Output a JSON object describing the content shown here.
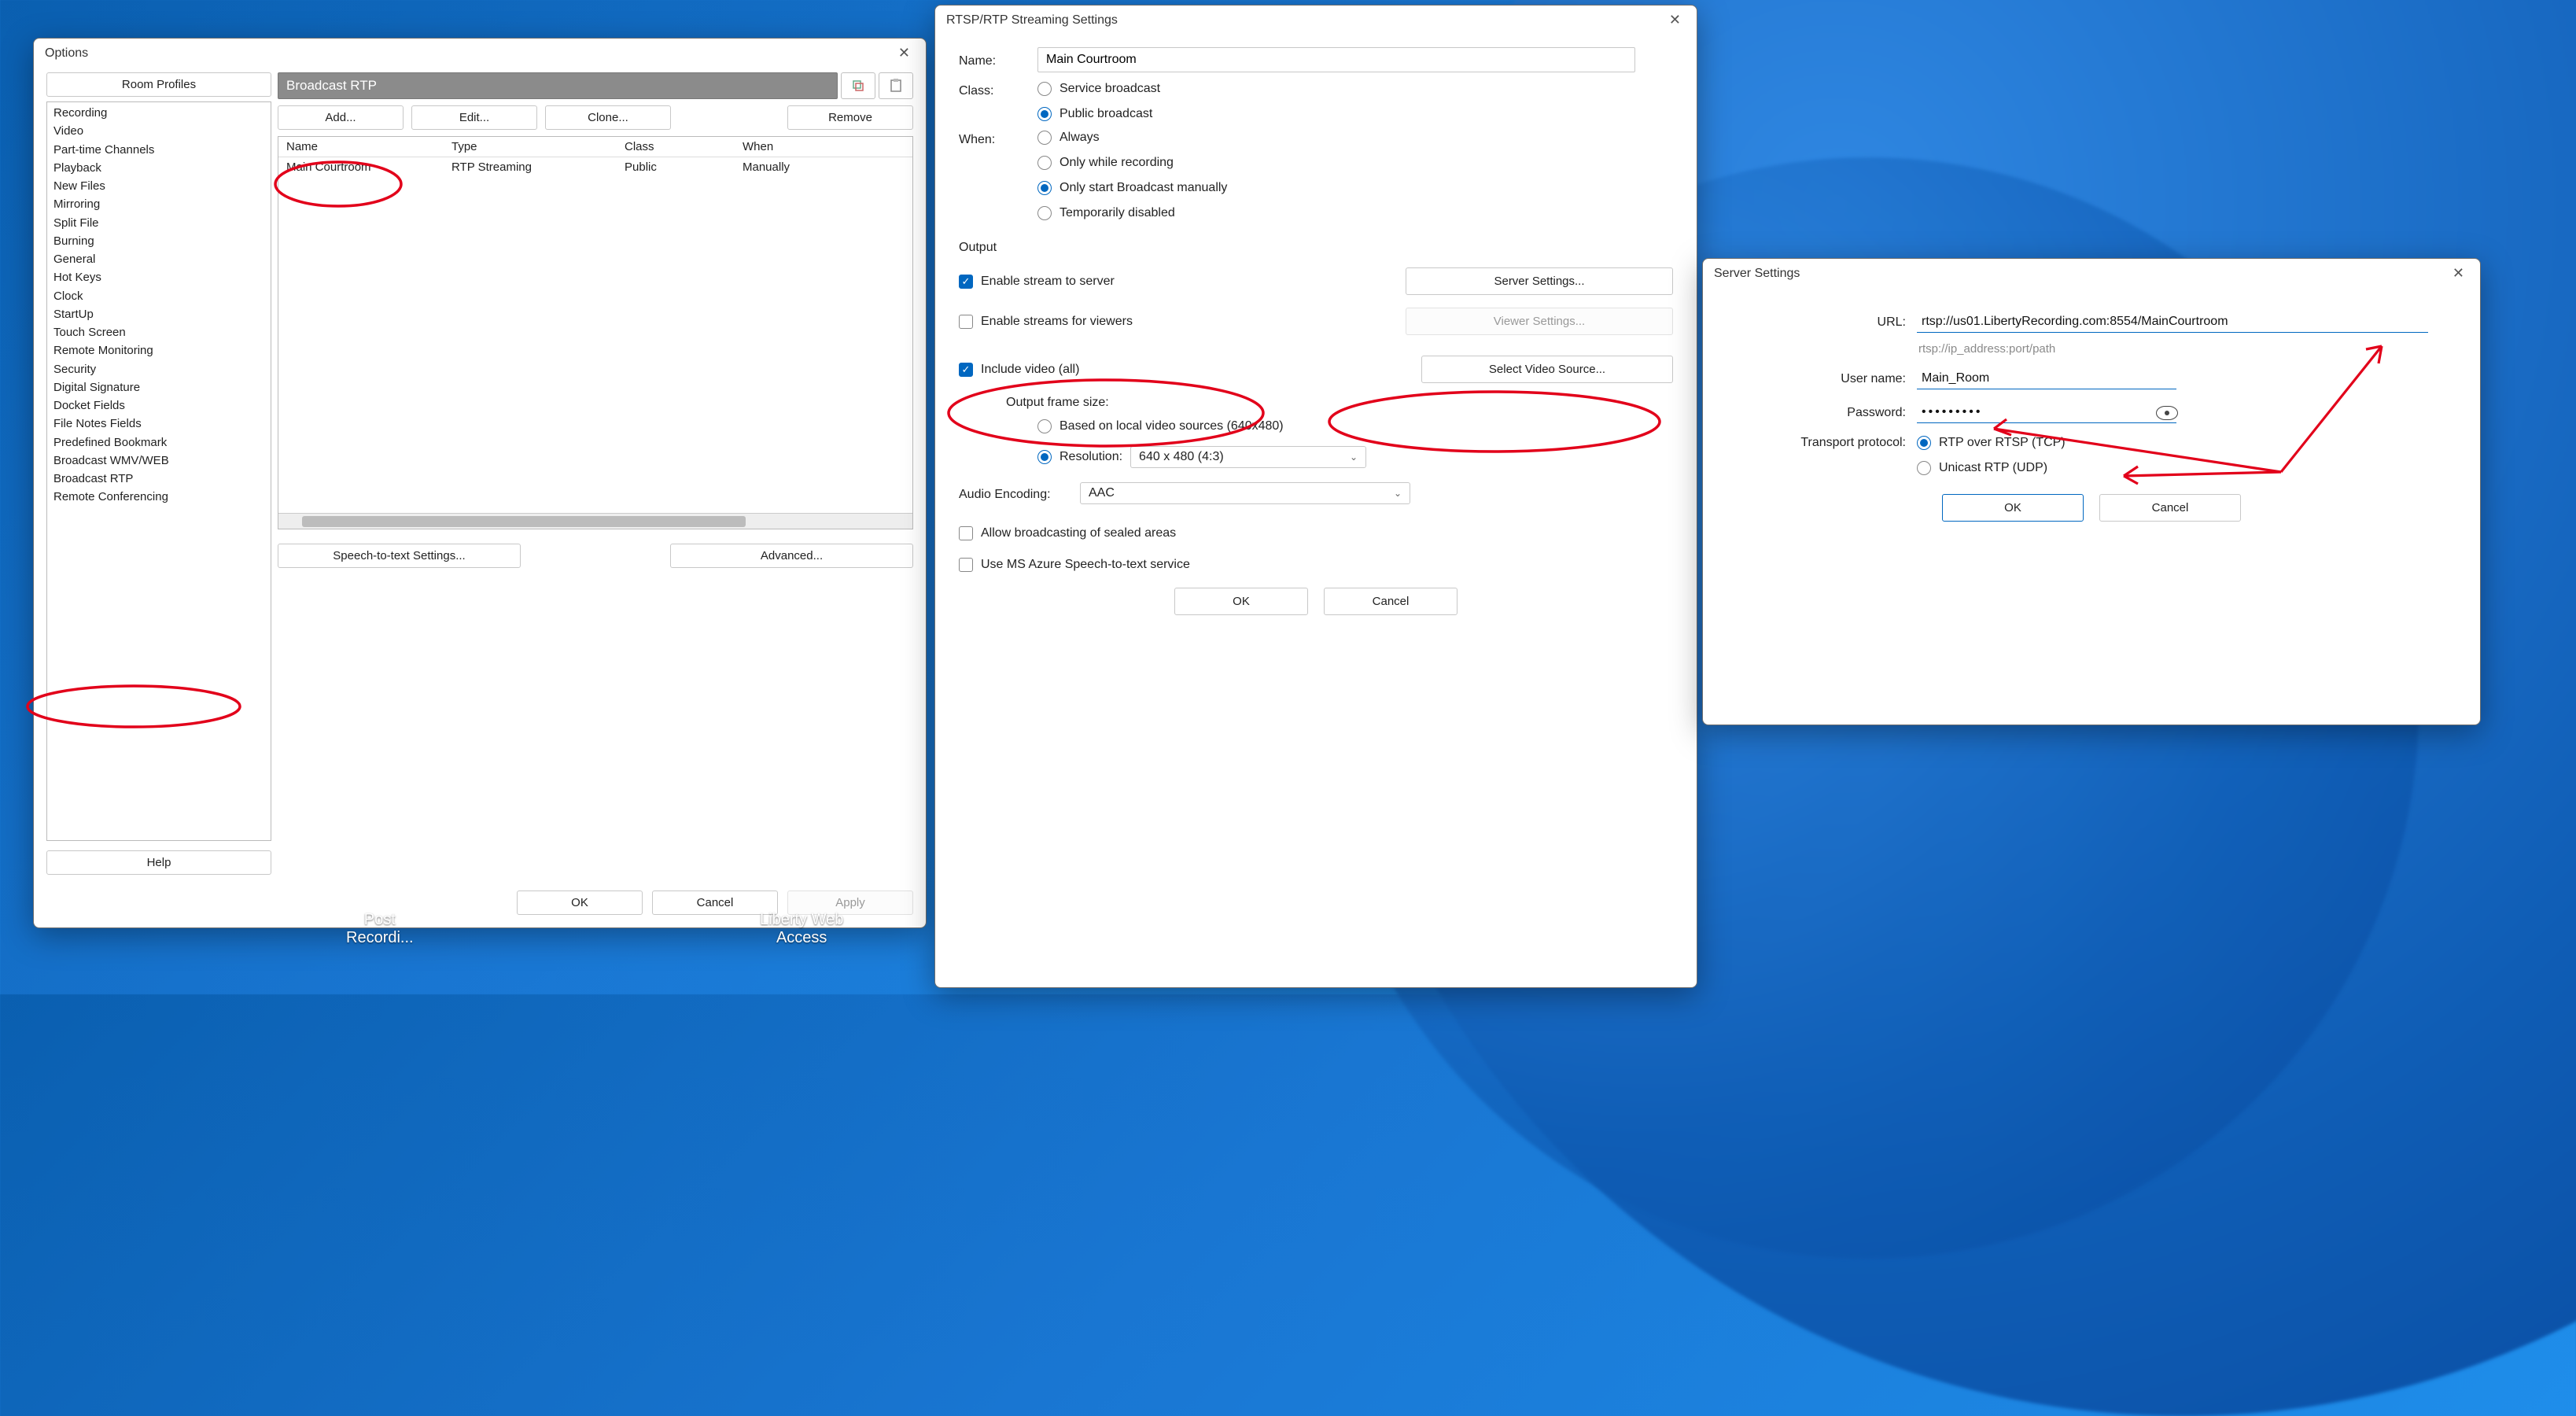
{
  "options": {
    "title": "Options",
    "room_profiles": "Room Profiles",
    "sidebar": [
      "Recording",
      "Video",
      "Part-time Channels",
      "Playback",
      "New Files",
      "Mirroring",
      "Split File",
      "Burning",
      "General",
      "Hot Keys",
      "Clock",
      "StartUp",
      "Touch Screen",
      "Remote Monitoring",
      "Security",
      "Digital Signature",
      "Docket Fields",
      "File Notes Fields",
      "Predefined Bookmark",
      "Broadcast WMV/WEB",
      "Broadcast RTP",
      "Remote Conferencing"
    ],
    "header_name": "Broadcast RTP",
    "actions": {
      "add": "Add...",
      "edit": "Edit...",
      "clone": "Clone...",
      "remove": "Remove"
    },
    "columns": {
      "name": "Name",
      "type": "Type",
      "class": "Class",
      "when": "When"
    },
    "rows": [
      {
        "name": "Main Courtroom",
        "type": "RTP Streaming",
        "class": "Public",
        "when": "Manually"
      }
    ],
    "speech_btn": "Speech-to-text Settings...",
    "advanced_btn": "Advanced...",
    "help": "Help",
    "ok": "OK",
    "cancel": "Cancel",
    "apply": "Apply"
  },
  "rtsp": {
    "title": "RTSP/RTP Streaming Settings",
    "name_label": "Name:",
    "name_value": "Main Courtroom",
    "class_label": "Class:",
    "class_options": {
      "service": "Service broadcast",
      "public": "Public broadcast"
    },
    "when_label": "When:",
    "when_options": {
      "always": "Always",
      "recording": "Only while recording",
      "manual": "Only start Broadcast manually",
      "disabled": "Temporarily disabled"
    },
    "output_title": "Output",
    "enable_server": "Enable stream to server",
    "server_settings": "Server Settings...",
    "enable_viewers": "Enable streams for viewers",
    "viewer_settings": "Viewer Settings...",
    "include_video": "Include video (all)",
    "select_video": "Select Video Source...",
    "frame_size_label": "Output frame size:",
    "frame_based": "Based on local video sources (640x480)",
    "frame_res_label": "Resolution:",
    "frame_res_value": "640 x 480  (4:3)",
    "audio_label": "Audio Encoding:",
    "audio_value": "AAC",
    "allow_sealed": "Allow broadcasting of sealed areas",
    "azure_stt": "Use MS Azure Speech-to-text service",
    "ok": "OK",
    "cancel": "Cancel"
  },
  "server": {
    "title": "Server Settings",
    "url_label": "URL:",
    "url_value": "rtsp://us01.LibertyRecording.com:8554/MainCourtroom",
    "url_hint": "rtsp://ip_address:port/path",
    "user_label": "User name:",
    "user_value": "Main_Room",
    "pass_label": "Password:",
    "pass_masked": "•••••••••",
    "transport_label": "Transport protocol:",
    "tp_tcp": "RTP over RTSP (TCP)",
    "tp_udp": "Unicast RTP (UDP)",
    "ok": "OK",
    "cancel": "Cancel"
  },
  "desktop": {
    "post": "Post\nRecordi...",
    "libweb": "Liberty Web\nAccess"
  }
}
